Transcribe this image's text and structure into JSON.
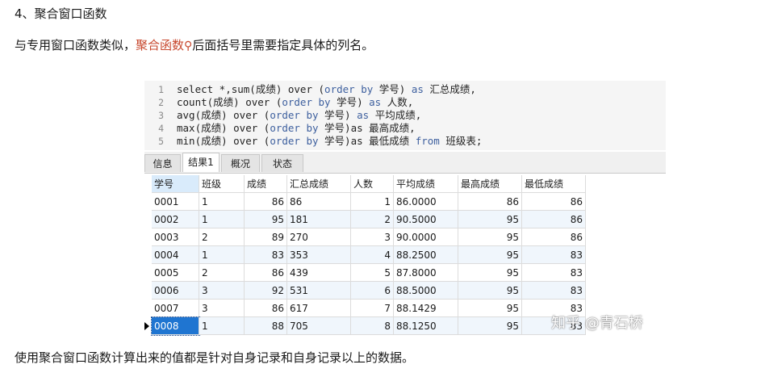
{
  "article": {
    "heading": "4、聚合窗口函数",
    "intro_prefix": "与专用窗口函数类似，",
    "intro_link": "聚合函数",
    "intro_suffix": "后面括号里需要指定具体的列名。",
    "footer": "使用聚合窗口函数计算出来的值都是针对自身记录和自身记录以上的数据。",
    "watermark": "知乎 @青石桥"
  },
  "sql": {
    "lines": [
      {
        "n": "1",
        "parts": [
          [
            "select *,sum(成绩) over (",
            "t"
          ],
          [
            "order by",
            "k"
          ],
          [
            " 学号) ",
            "t"
          ],
          [
            "as",
            "k"
          ],
          [
            " 汇总成绩,",
            "t"
          ]
        ]
      },
      {
        "n": "2",
        "parts": [
          [
            "count(成绩) over (",
            "t"
          ],
          [
            "order by",
            "k"
          ],
          [
            " 学号) ",
            "t"
          ],
          [
            "as",
            "k"
          ],
          [
            " 人数,",
            "t"
          ]
        ]
      },
      {
        "n": "3",
        "parts": [
          [
            "avg(成绩) over (",
            "t"
          ],
          [
            "order by",
            "k"
          ],
          [
            " 学号) ",
            "t"
          ],
          [
            "as",
            "k"
          ],
          [
            " 平均成绩,",
            "t"
          ]
        ]
      },
      {
        "n": "4",
        "parts": [
          [
            "max(成绩) over (",
            "t"
          ],
          [
            "order by",
            "k"
          ],
          [
            " 学号)as 最高成绩,",
            "t"
          ]
        ]
      },
      {
        "n": "5",
        "parts": [
          [
            "min(成绩) over (",
            "t"
          ],
          [
            "order by",
            "k"
          ],
          [
            " 学号)as 最低成绩 ",
            "t"
          ],
          [
            "from",
            "k"
          ],
          [
            " 班级表;",
            "t"
          ]
        ]
      }
    ]
  },
  "tabs": [
    "信息",
    "结果1",
    "概况",
    "状态"
  ],
  "active_tab": "结果1",
  "table": {
    "headers": [
      "学号",
      "班级",
      "成绩",
      "汇总成绩",
      "人数",
      "平均成绩",
      "最高成绩",
      "最低成绩"
    ],
    "rows": [
      [
        "0001",
        "1",
        "86",
        "86",
        "1",
        "86.0000",
        "86",
        "86"
      ],
      [
        "0002",
        "1",
        "95",
        "181",
        "2",
        "90.5000",
        "95",
        "86"
      ],
      [
        "0003",
        "2",
        "89",
        "270",
        "3",
        "90.0000",
        "95",
        "86"
      ],
      [
        "0004",
        "1",
        "83",
        "353",
        "4",
        "88.2500",
        "95",
        "83"
      ],
      [
        "0005",
        "2",
        "86",
        "439",
        "5",
        "87.8000",
        "95",
        "83"
      ],
      [
        "0006",
        "3",
        "92",
        "531",
        "6",
        "88.5000",
        "95",
        "83"
      ],
      [
        "0007",
        "3",
        "86",
        "617",
        "7",
        "88.1429",
        "95",
        "83"
      ],
      [
        "0008",
        "1",
        "88",
        "705",
        "8",
        "88.1250",
        "95",
        "83"
      ]
    ],
    "selected_row": "0008"
  },
  "colors": {
    "link": "#c7472d",
    "keyword": "#3d5f9e",
    "selection": "#1f75d1"
  },
  "icons": {
    "search": "search-icon",
    "row_marker": "current-row-arrow-icon"
  }
}
